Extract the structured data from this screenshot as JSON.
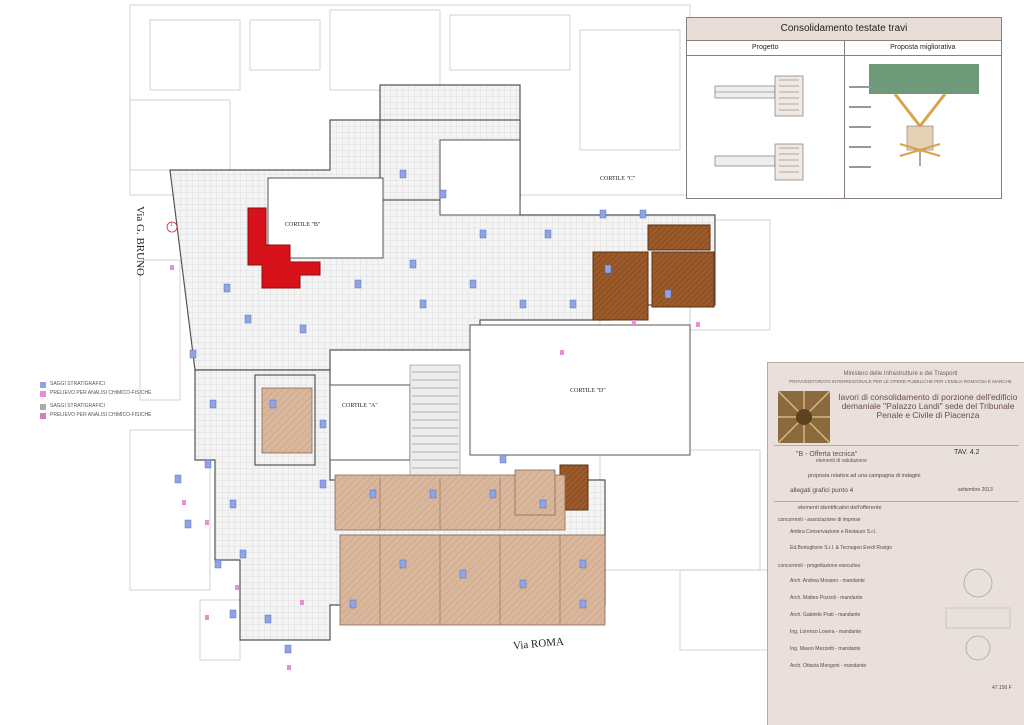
{
  "detail_panel": {
    "title": "Consolidamento testate travi",
    "col_left": "Progetto",
    "col_right": "Proposta migliorativa"
  },
  "streets": {
    "west": "Via G. BRUNO",
    "south": "Via ROMA",
    "marker": "1"
  },
  "courtyards": {
    "a": "CORTILE \"A\"",
    "b": "CORTILE \"B\"",
    "c": "CORTILE \"C\"",
    "d": "CORTILE \"D\""
  },
  "legend": [
    {
      "label": "SAGGI STRATIGRAFICI",
      "color": "#8fa3e6"
    },
    {
      "label": "PRELIEVO PER ANALISI CHIMICO-FISICHE",
      "color": "#e78fd6"
    },
    {
      "label": "SAGGI STRATIGRAFICI",
      "color": "#aaaaaa"
    },
    {
      "label": "PRELIEVO PER ANALISI CHIMICO-FISICHE",
      "color": "#d37fc4"
    }
  ],
  "title_block": {
    "ministry_line1": "Ministero delle Infrastrutture e dei Trasporti",
    "ministry_line2": "PROVVEDITORATO INTERREGIONALE PER LE OPERE PUBBLICHE PER L'EMILIA ROMAGNA E MARCHE",
    "project_title": "lavori di consolidamento di porzione dell'edificio demaniale \"Palazzo Landi\" sede del Tribunale Penale e Civile di Piacenza",
    "offer": "\"B - Offerta tecnica\"",
    "offer_sub": "elementi di valutazione",
    "tav_label": "TAV.",
    "tav_value": "4.2",
    "proposal": "proposta relativa ad una campagna di indagini",
    "attachments": "allegati grafici punto 4",
    "date": "settembre 2013",
    "section_offerer": "elementi identificativi dell'offerente",
    "companies_header": "concorrenti - associazione di imprese",
    "company1": "Ambra Conservazione e Restauro S.r.l.",
    "company2": "Ed.Bortoglione S.r.l. & Tecnogeo Eredi Rovigo",
    "designers_header": "concorrenti - progettazione esecutiva",
    "arch1": "Arch. Andrea Mosano - mandante",
    "arch2": "Arch. Matteo Pozzoli - mandante",
    "arch3": "Arch. Gabriele Prati - mandante",
    "eng1": "Ing. Lorenzo Lovera - mandante",
    "eng2": "Ing. Mauro Mezzetti - mandante",
    "arch4": "Arch. Ottavia Mengoni - mandante",
    "code": "47.150 F"
  }
}
